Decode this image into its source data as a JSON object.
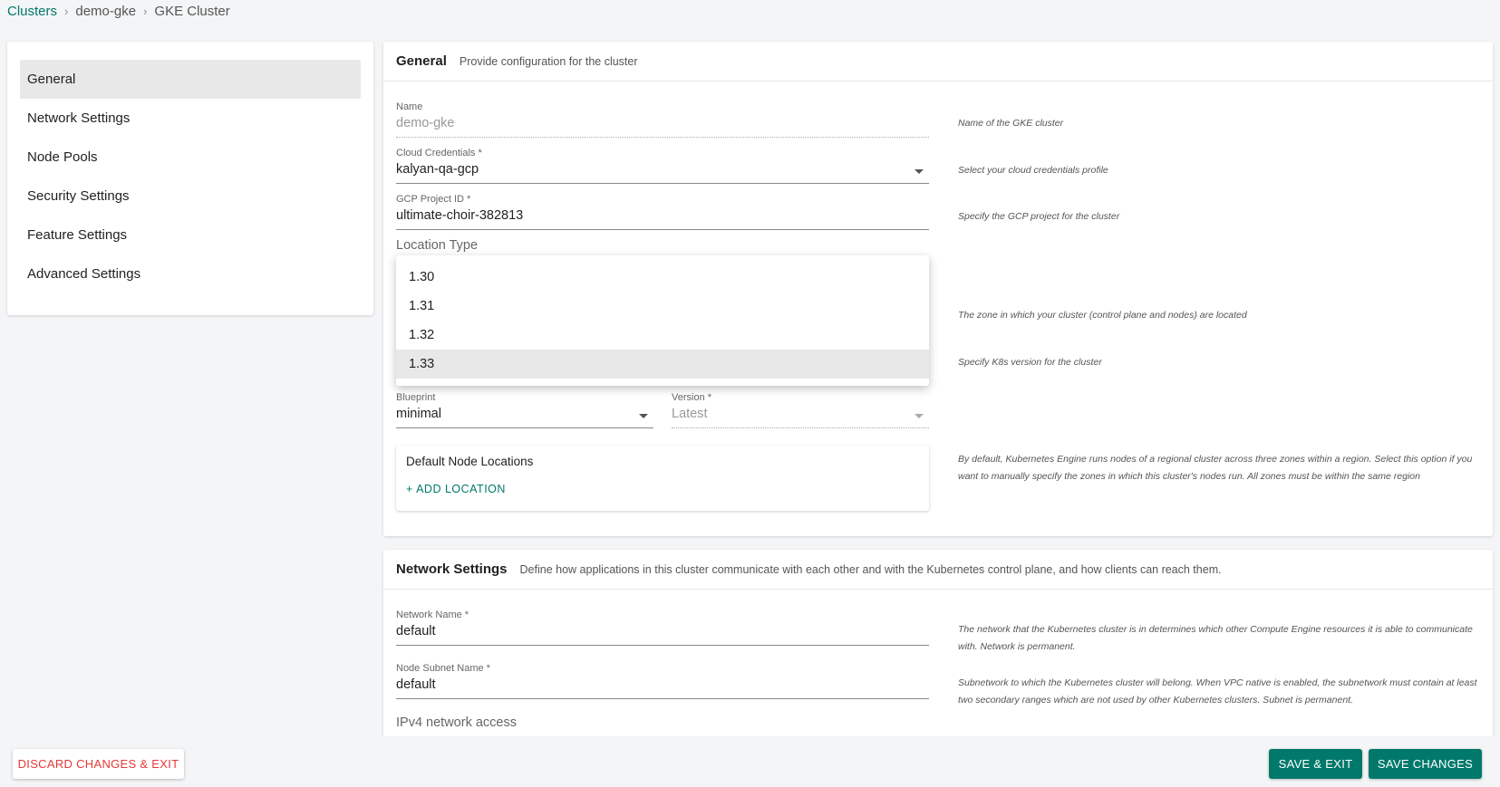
{
  "breadcrumb": {
    "root": "Clusters",
    "cluster": "demo-gke",
    "current": "GKE Cluster",
    "separator": "›"
  },
  "sidebar": {
    "items": [
      {
        "label": "General"
      },
      {
        "label": "Network Settings"
      },
      {
        "label": "Node Pools"
      },
      {
        "label": "Security Settings"
      },
      {
        "label": "Feature Settings"
      },
      {
        "label": "Advanced Settings"
      }
    ],
    "active": "General"
  },
  "general": {
    "title": "General",
    "description": "Provide configuration for the cluster",
    "name": {
      "label": "Name",
      "value": "demo-gke",
      "help": "Name of the GKE cluster"
    },
    "cloud_credentials": {
      "label": "Cloud Credentials *",
      "value": "kalyan-qa-gcp",
      "help": "Select your cloud credentials profile"
    },
    "project_id": {
      "label": "GCP Project ID *",
      "value": "ultimate-choir-382813",
      "help": "Specify the GCP project for the cluster"
    },
    "location_type": {
      "label": "Location Type"
    },
    "zone_help": "The zone in which your cluster (control plane and nodes) are located",
    "k8s_version_help": "Specify K8s version for the cluster",
    "blueprint": {
      "label": "Blueprint",
      "value": "minimal"
    },
    "version": {
      "label": "Version *",
      "value": "Latest"
    },
    "node_locations": {
      "title": "Default Node Locations",
      "add_label": "+ ADD  LOCATION",
      "help": "By default, Kubernetes Engine runs nodes of a regional cluster across three zones within a region. Select this option if you want to manually specify the zones in which this cluster's nodes run. All zones must be within the same region"
    }
  },
  "version_dropdown": {
    "options": [
      "1.30",
      "1.31",
      "1.32",
      "1.33"
    ],
    "highlighted": "1.33"
  },
  "network": {
    "title": "Network Settings",
    "description": "Define how applications in this cluster communicate with each other and with the Kubernetes control plane, and how clients can reach them.",
    "network_name": {
      "label": "Network Name *",
      "value": "default",
      "help": "The network that the Kubernetes cluster is in determines which other Compute Engine resources it is able to communicate with. Network is permanent."
    },
    "node_subnet": {
      "label": "Node Subnet Name *",
      "value": "default",
      "help": "Subnetwork to which the Kubernetes cluster will belong. When VPC native is enabled, the subnetwork must contain at least two secondary ranges which are not used by other Kubernetes clusters. Subnet is permanent."
    },
    "ipv4_access": {
      "label": "IPv4 network access"
    }
  },
  "footer": {
    "discard_label": "DISCARD CHANGES & EXIT",
    "save_exit_label": "SAVE & EXIT",
    "save_label": "SAVE CHANGES"
  },
  "colors": {
    "accent": "#00796b",
    "danger": "#e53935",
    "background": "#f4f5f7"
  }
}
